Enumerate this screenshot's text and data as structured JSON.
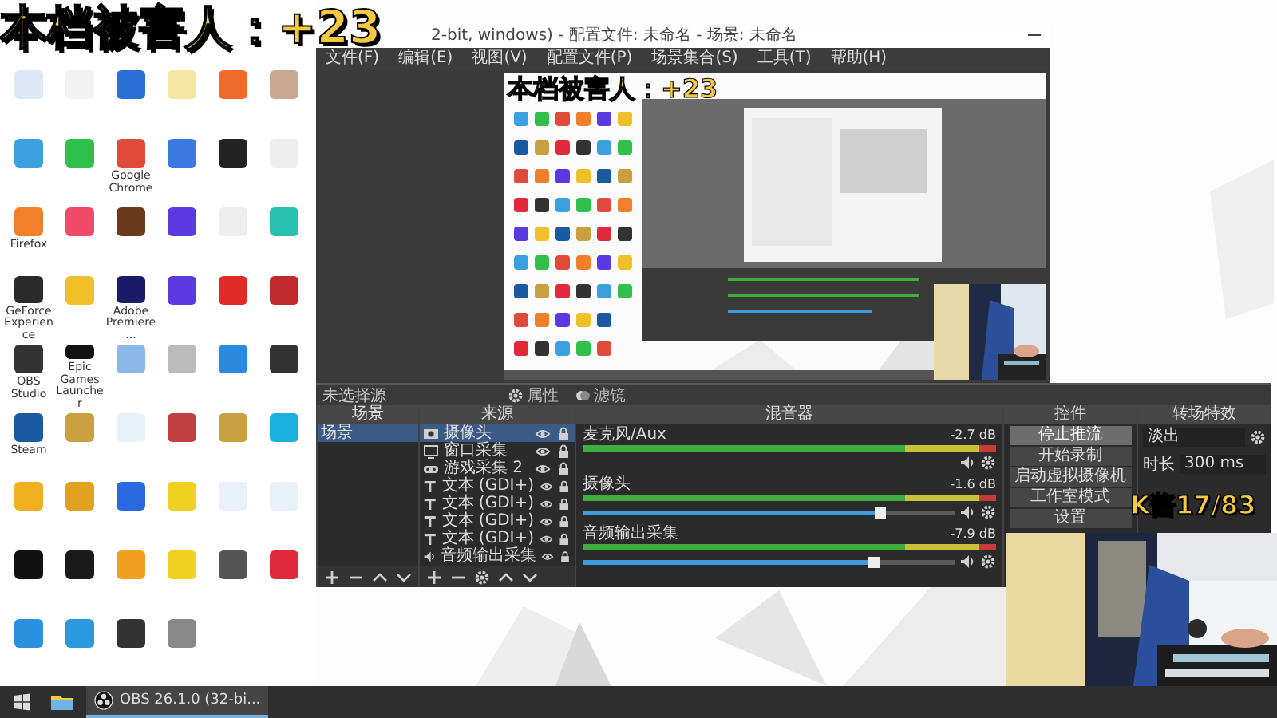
{
  "overlay_title": "本档被害人：+23",
  "overlay_score": "K酱17/83",
  "desktop_icons": [
    {
      "color": "#dbe8f5"
    },
    {
      "color": "#f2f2f2"
    },
    {
      "color": "#2a6fd6"
    },
    {
      "color": "#f5e6a0"
    },
    {
      "color": "#f06a2a"
    },
    {
      "color": "#c8a890"
    },
    {
      "color": "#3aa0e0"
    },
    {
      "color": "#2ec04a"
    },
    {
      "color": "#e04a3a",
      "label": "Google Chrome"
    },
    {
      "color": "#3a7ae0"
    },
    {
      "color": "#222222"
    },
    {
      "color": "#eeeeee"
    },
    {
      "color": "#f0802a",
      "label": "Firefox"
    },
    {
      "color": "#f04a6a"
    },
    {
      "color": "#6a3a1a"
    },
    {
      "color": "#5a3ae0"
    },
    {
      "color": "#eeeeee"
    },
    {
      "color": "#2ac0b0"
    },
    {
      "color": "#2a2a2a",
      "label": "GeForce Experience"
    },
    {
      "color": "#f0c02a"
    },
    {
      "color": "#1a1a6a",
      "label": "Adobe Premiere..."
    },
    {
      "color": "#5a3ae0"
    },
    {
      "color": "#e02a2a"
    },
    {
      "color": "#c02a2a"
    },
    {
      "color": "#333333",
      "label": "OBS Studio"
    },
    {
      "color": "#111111",
      "label": "Epic Games Launcher"
    },
    {
      "color": "#8ab8e8"
    },
    {
      "color": "#bbbbbb"
    },
    {
      "color": "#2a8ae0"
    },
    {
      "color": "#333333"
    },
    {
      "color": "#1a5aa0",
      "label": "Steam"
    },
    {
      "color": "#c8a040"
    },
    {
      "color": "#e8f0fa"
    },
    {
      "color": "#c04040"
    },
    {
      "color": "#c8a040"
    },
    {
      "color": "#1ab0e0"
    },
    {
      "color": "#f0b020"
    },
    {
      "color": "#e0a020"
    },
    {
      "color": "#2a6ae0"
    },
    {
      "color": "#f0d020"
    },
    {
      "color": "#e8f0fa"
    },
    {
      "color": "#e8f0fa"
    },
    {
      "color": "#111111"
    },
    {
      "color": "#1a1a1a"
    },
    {
      "color": "#f0a020"
    },
    {
      "color": "#f0d020"
    },
    {
      "color": "#555555"
    },
    {
      "color": "#e02a3a"
    },
    {
      "color": "#2a90e0"
    },
    {
      "color": "#2a9ae0"
    },
    {
      "color": "#333333"
    },
    {
      "color": "#888888"
    }
  ],
  "obs": {
    "title": "2-bit, windows) - 配置文件: 未命名 - 场景: 未命名",
    "menu": [
      "文件(F)",
      "编辑(E)",
      "视图(V)",
      "配置文件(P)",
      "场景集合(S)",
      "工具(T)",
      "帮助(H)"
    ],
    "preview": {
      "overlay_text": "本档被害人：+23"
    },
    "source_bar": {
      "label": "未选择源",
      "buttons": [
        "属性",
        "滤镜"
      ]
    },
    "scenes": {
      "title": "场景",
      "items": [
        {
          "label": "场景",
          "selected": true
        }
      ]
    },
    "sources": {
      "title": "来源",
      "items": [
        {
          "label": "摄像头",
          "kind": "camera",
          "selected": true
        },
        {
          "label": "窗口采集",
          "kind": "window",
          "selected": false
        },
        {
          "label": "游戏采集 2",
          "kind": "game",
          "selected": false
        },
        {
          "label": "文本 (GDI+)",
          "kind": "text",
          "selected": false
        },
        {
          "label": "文本 (GDI+)",
          "kind": "text",
          "selected": false
        },
        {
          "label": "文本 (GDI+)",
          "kind": "text",
          "selected": false
        },
        {
          "label": "文本 (GDI+)",
          "kind": "text",
          "selected": false
        },
        {
          "label": "音频输出采集",
          "kind": "audio",
          "selected": false
        }
      ]
    },
    "mixer": {
      "title": "混音器",
      "channels": [
        {
          "name": "麦克风/Aux",
          "reading": "-2.7 dB"
        },
        {
          "name": "摄像头",
          "reading": "-1.6 dB",
          "level": 0.8
        },
        {
          "name": "音频输出采集",
          "reading": "-7.9 dB",
          "level": 0.78
        }
      ]
    },
    "controls": {
      "title": "控件",
      "buttons": [
        {
          "label": "停止推流",
          "active": true
        },
        {
          "label": "开始录制",
          "active": false
        },
        {
          "label": "启动虚拟摄像机",
          "active": false
        },
        {
          "label": "工作室模式",
          "active": false
        },
        {
          "label": "设置",
          "active": false
        }
      ]
    },
    "transitions": {
      "title": "转场特效",
      "type": "淡出",
      "duration_label": "时长",
      "duration": "300 ms"
    }
  },
  "taskbar": {
    "items": [
      {
        "kind": "start"
      },
      {
        "kind": "explorer"
      },
      {
        "kind": "app",
        "label": "OBS 26.1.0 (32-bi...",
        "active": true
      }
    ]
  }
}
